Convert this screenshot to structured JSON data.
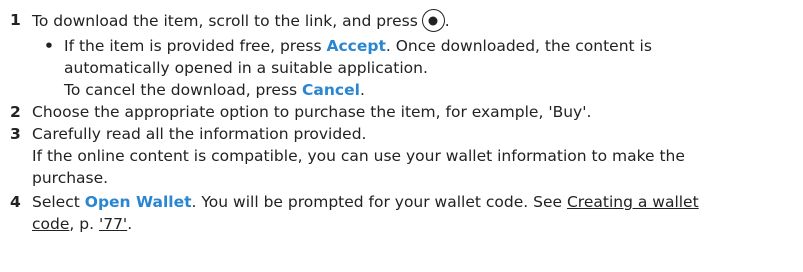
{
  "steps": [
    {
      "number": "1",
      "text_a": "To download the item, scroll to the link, and press",
      "text_b": ".",
      "icon": "joystick-select-icon"
    },
    {
      "number": "2",
      "text": "Choose the appropriate option to purchase the item, for example, 'Buy'."
    },
    {
      "number": "3",
      "line1": "Carefully read all the information provided.",
      "line2": "If the online content is compatible, you can use your wallet information to make the",
      "line3": "purchase."
    },
    {
      "number": "4",
      "pre": "Select",
      "keyword": "Open Wallet",
      "mid": ". You will be prompted for your wallet code. See",
      "link1": "Creating a wallet",
      "link2": "code",
      "post": ", p.",
      "page_ref": "'77'",
      "end": "."
    }
  ],
  "bullet": {
    "symbol": "•",
    "pre": "If the item is provided free, press",
    "accept": "Accept",
    "after_accept": ". Once downloaded, the content is",
    "line2": "automatically opened in a suitable application.",
    "cancel_pre": "To cancel the download, press",
    "cancel": "Cancel",
    "cancel_end": "."
  },
  "colors": {
    "text": "#222222",
    "keyword": "#2a86d0"
  }
}
